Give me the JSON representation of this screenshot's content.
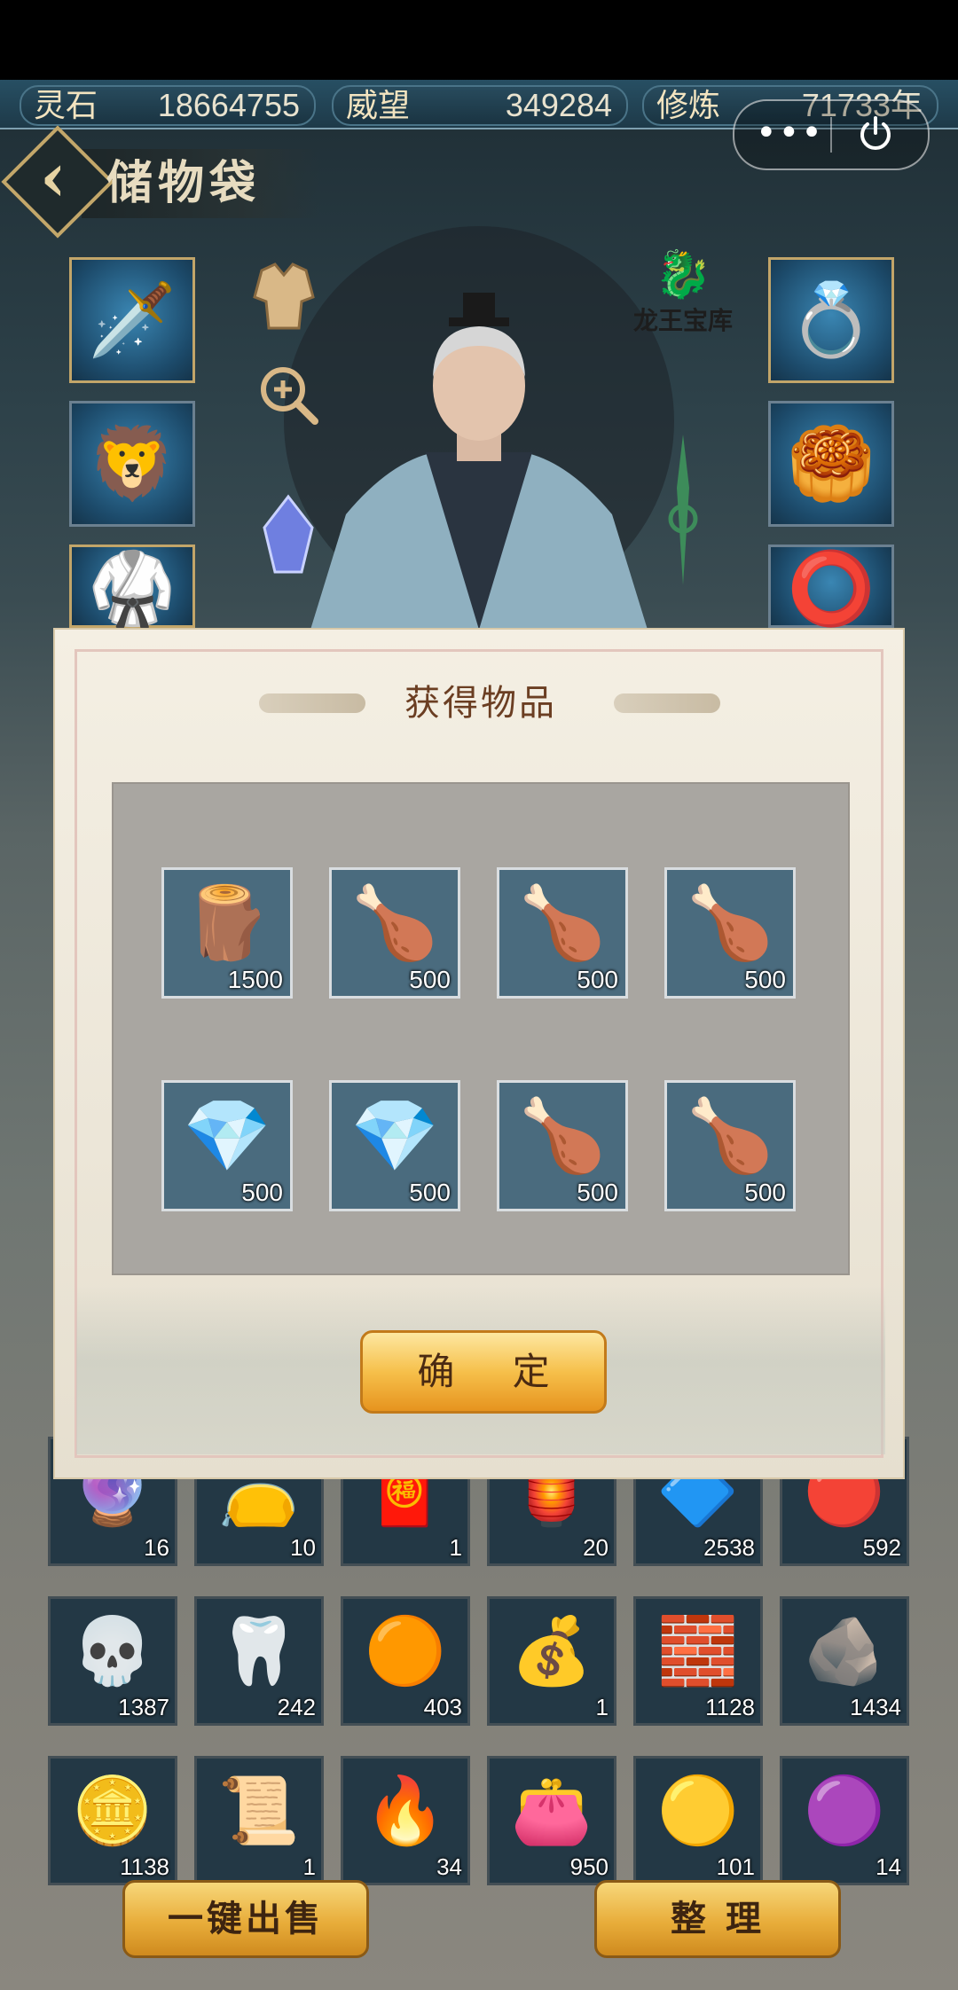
{
  "resources": [
    {
      "label": "灵石",
      "value": "18664755"
    },
    {
      "label": "威望",
      "value": "349284"
    },
    {
      "label": "修炼",
      "value": "71733年"
    }
  ],
  "capsule": {
    "more": "•••"
  },
  "header": {
    "back_glyph": "‹",
    "title": "储物袋"
  },
  "treasury_label": "龙王宝库",
  "dialog": {
    "title": "获得物品",
    "confirm_label": "确 定",
    "rewards": [
      {
        "icon": "wood-log-icon",
        "glyph": "🪵",
        "qty": "1500"
      },
      {
        "icon": "roast-meat-icon",
        "glyph": "🍗",
        "qty": "500"
      },
      {
        "icon": "roast-meat-icon",
        "glyph": "🍗",
        "qty": "500"
      },
      {
        "icon": "roast-meat-icon",
        "glyph": "🍗",
        "qty": "500"
      },
      {
        "icon": "spirit-crystal-icon",
        "glyph": "💎",
        "qty": "500"
      },
      {
        "icon": "spirit-crystal-icon",
        "glyph": "💎",
        "qty": "500"
      },
      {
        "icon": "roast-meat-icon",
        "glyph": "🍗",
        "qty": "500"
      },
      {
        "icon": "roast-meat-icon",
        "glyph": "🍗",
        "qty": "500"
      }
    ]
  },
  "inventory_rows": [
    [
      {
        "icon": "orb-icon",
        "glyph": "🔮",
        "qty": "16"
      },
      {
        "icon": "pouch-icon",
        "glyph": "👝",
        "qty": "10"
      },
      {
        "icon": "festival-card-icon",
        "glyph": "🧧",
        "qty": "1"
      },
      {
        "icon": "lantern-icon",
        "glyph": "🏮",
        "qty": "20"
      },
      {
        "icon": "blue-gem-icon",
        "glyph": "🔷",
        "qty": "2538"
      },
      {
        "icon": "red-orb-icon",
        "glyph": "🔴",
        "qty": "592"
      }
    ],
    [
      {
        "icon": "skull-icon",
        "glyph": "💀",
        "qty": "1387"
      },
      {
        "icon": "fang-icon",
        "glyph": "🦷",
        "qty": "242"
      },
      {
        "icon": "golden-orb-icon",
        "glyph": "🟠",
        "qty": "403"
      },
      {
        "icon": "treasure-bag-icon",
        "glyph": "💰",
        "qty": "1"
      },
      {
        "icon": "wood-block-icon",
        "glyph": "🧱",
        "qty": "1128"
      },
      {
        "icon": "jade-stone-icon",
        "glyph": "🪨",
        "qty": "1434"
      }
    ],
    [
      {
        "icon": "gold-bar-icon",
        "glyph": "🪙",
        "qty": "1138"
      },
      {
        "icon": "jade-token-icon",
        "glyph": "📜",
        "qty": "1"
      },
      {
        "icon": "fire-orb-icon",
        "glyph": "🔥",
        "qty": "34"
      },
      {
        "icon": "grain-bag-icon",
        "glyph": "👛",
        "qty": "950"
      },
      {
        "icon": "yellow-orb-icon",
        "glyph": "🟡",
        "qty": "101"
      },
      {
        "icon": "purple-amulet-icon",
        "glyph": "🟣",
        "qty": "14"
      }
    ]
  ],
  "buttons": {
    "sell_all": "一键出售",
    "organize": "整 理"
  },
  "colors": {
    "gold_border": "#c2a569",
    "confirm_gold": "#f6c04b",
    "title_brown": "#6b3e22"
  }
}
